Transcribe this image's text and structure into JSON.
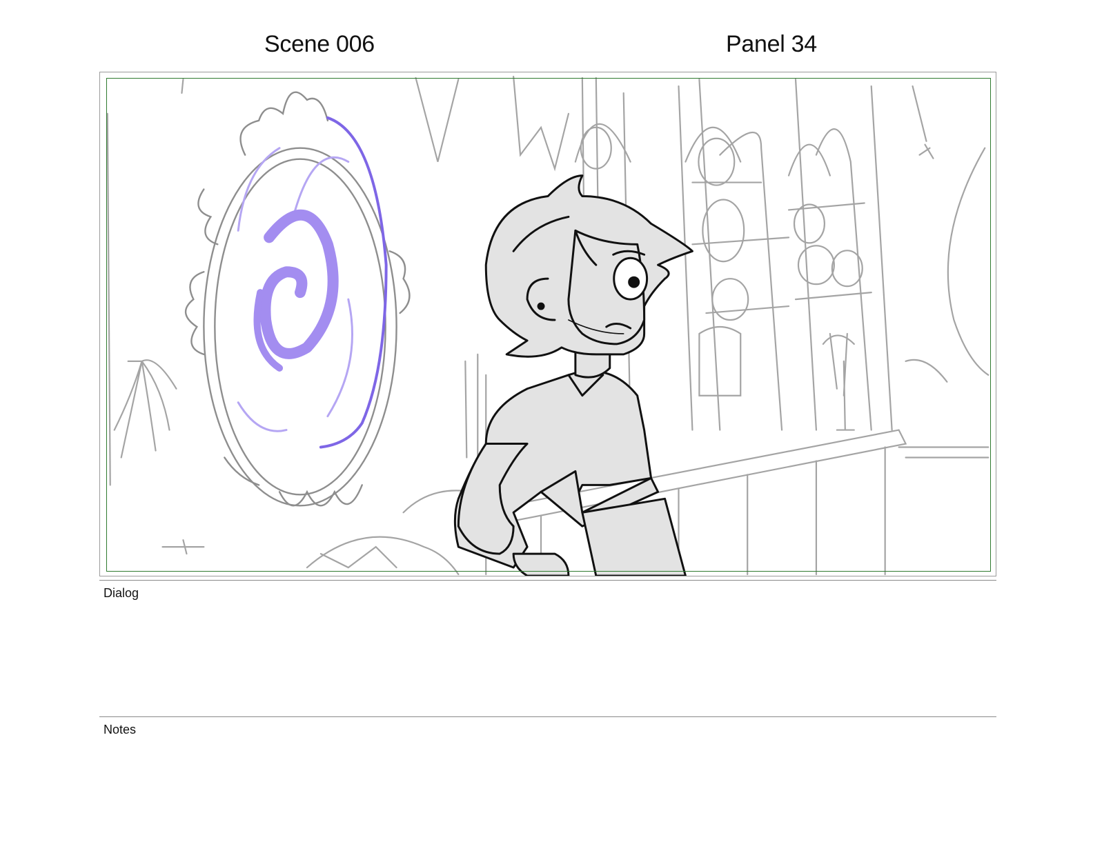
{
  "header": {
    "scene": "Scene 006",
    "panel": "Panel 34"
  },
  "panel_image": {
    "icon": "storyboard-sketch",
    "colors": {
      "safe_area": "#2e7a2e",
      "portal": "#a38df0",
      "portal_rim": "#7e66e6",
      "character_fill": "#e3e3e3",
      "sketch_line": "#9a9a9a"
    }
  },
  "sections": {
    "dialog_label": "Dialog",
    "dialog_text": "",
    "notes_label": "Notes",
    "notes_text": ""
  }
}
